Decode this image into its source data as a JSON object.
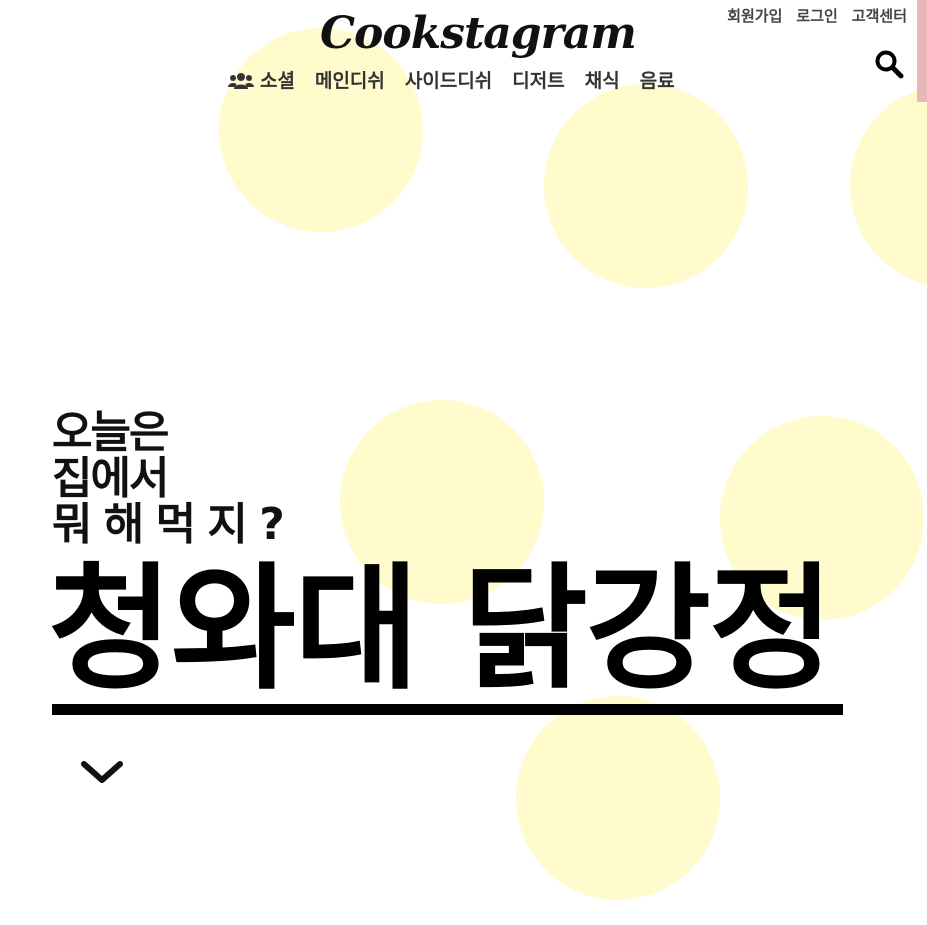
{
  "header": {
    "logo": "Cookstagram",
    "util_links": [
      "회원가입",
      "로그인",
      "고객센터"
    ],
    "search_icon": "search-icon"
  },
  "main_nav": {
    "items": [
      {
        "label": "소셜",
        "icon": "users-icon"
      },
      {
        "label": "메인디쉬"
      },
      {
        "label": "사이드디쉬"
      },
      {
        "label": "디저트"
      },
      {
        "label": "채식"
      },
      {
        "label": "음료"
      }
    ]
  },
  "hero": {
    "subtitle_lines": [
      "오늘은",
      "집에서",
      "뭐 해 먹 지 ?"
    ],
    "title": "청와대 닭강정",
    "scroll_icon": "chevron-down-icon"
  },
  "colors": {
    "dot": "#fffbcc",
    "text": "#111111",
    "nav_text": "#333333",
    "util_text": "#444444",
    "accent": "#e8b7b7"
  }
}
